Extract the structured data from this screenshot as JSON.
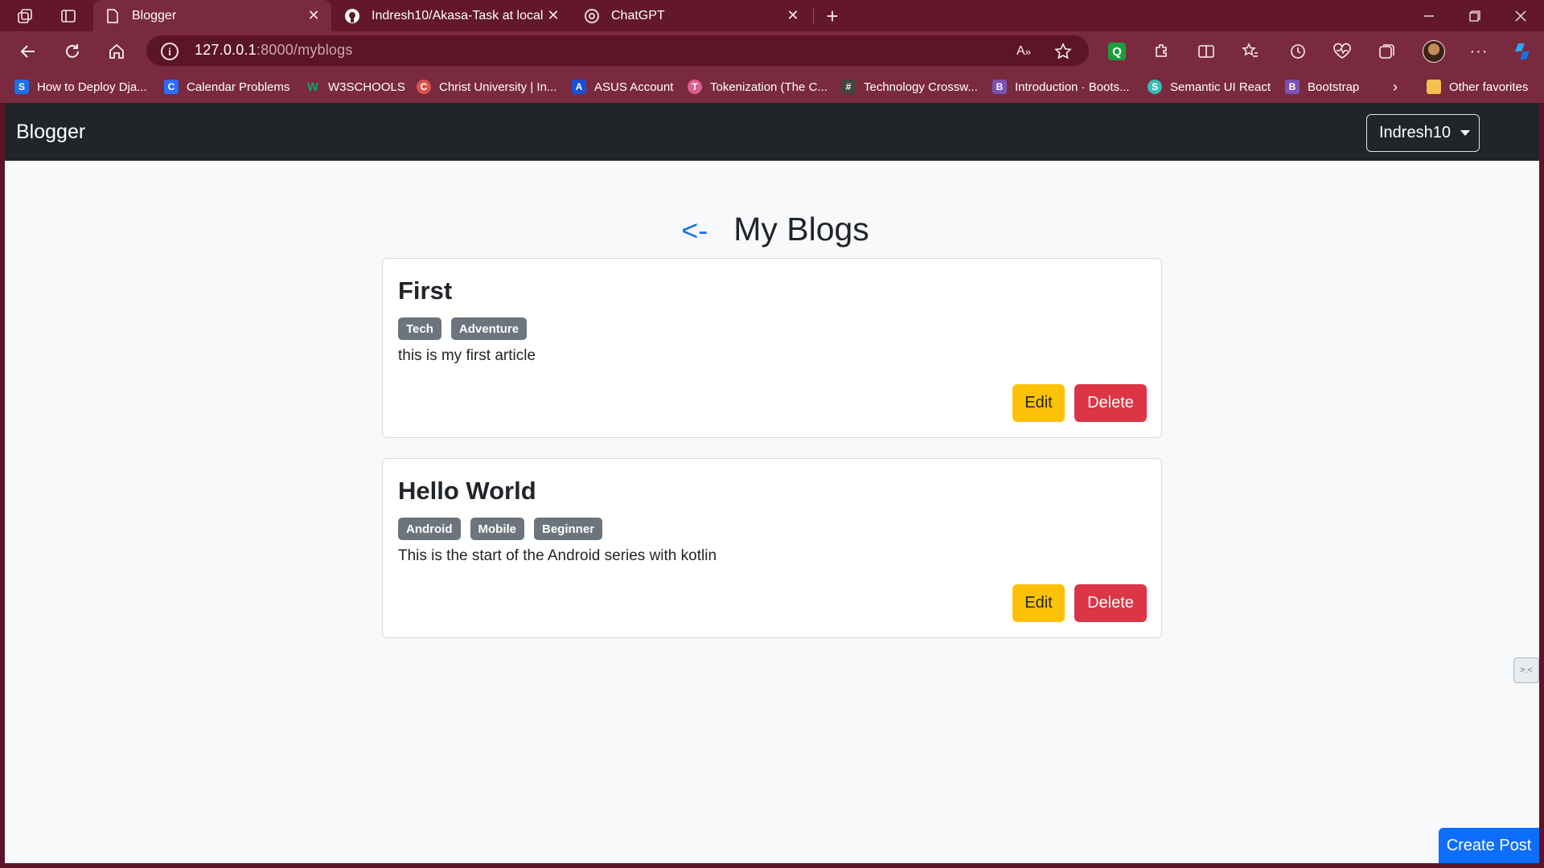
{
  "browser": {
    "tabs": [
      {
        "title": "Blogger",
        "icon": "page-icon",
        "active": true
      },
      {
        "title": "Indresh10/Akasa-Task at local",
        "icon": "github-icon",
        "active": false
      },
      {
        "title": "ChatGPT",
        "icon": "chatgpt-icon",
        "active": false
      }
    ],
    "address": {
      "host": "127.0.0.1",
      "path": ":8000/myblogs"
    },
    "bookmarks": [
      {
        "label": "How to Deploy Dja...",
        "icon": "S",
        "color": "#1f6feb"
      },
      {
        "label": "Calendar Problems",
        "icon": "C",
        "color": "#2b6cff"
      },
      {
        "label": "W3SCHOOLS",
        "icon": "W",
        "color": "#04aa6d"
      },
      {
        "label": "Christ University | In...",
        "icon": "C",
        "color": "#d9534f"
      },
      {
        "label": "ASUS Account",
        "icon": "A",
        "color": "#1a4fd8"
      },
      {
        "label": "Tokenization (The C...",
        "icon": "T",
        "color": "#e05d8c"
      },
      {
        "label": "Technology Crossw...",
        "icon": "#",
        "color": "#444444"
      },
      {
        "label": "Introduction · Boots...",
        "icon": "B",
        "color": "#7952b3"
      },
      {
        "label": "Semantic UI React",
        "icon": "S",
        "color": "#35bdb2"
      },
      {
        "label": "Bootstrap",
        "icon": "B",
        "color": "#7952b3"
      }
    ],
    "other_favorites": "Other favorites"
  },
  "app": {
    "brand": "Blogger",
    "user": "Indresh10",
    "back_label": "<-",
    "page_title": "My Blogs",
    "create_post": "Create Post",
    "widget": ">.<",
    "posts": [
      {
        "title": "First",
        "tags": [
          "Tech",
          "Adventure"
        ],
        "body": "this is my first article",
        "edit": "Edit",
        "delete": "Delete"
      },
      {
        "title": "Hello World",
        "tags": [
          "Android",
          "Mobile",
          "Beginner"
        ],
        "body": "This is the start of the Android series with kotlin",
        "edit": "Edit",
        "delete": "Delete"
      }
    ]
  },
  "colors": {
    "chrome": "#7a2a3e",
    "primary": "#0d6efd",
    "warning": "#ffc107",
    "danger": "#dc3545",
    "badge": "#6c757d"
  }
}
